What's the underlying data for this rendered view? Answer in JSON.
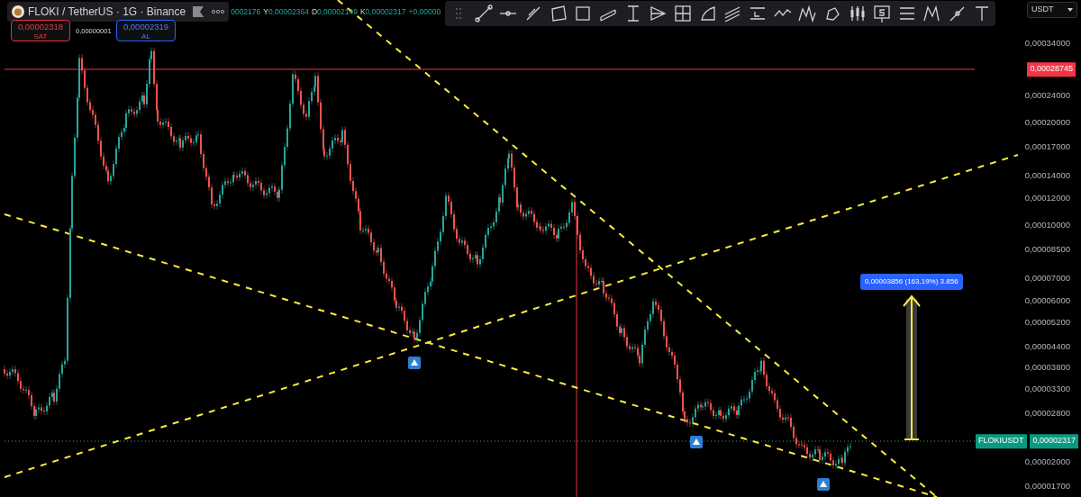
{
  "header": {
    "pair": "FLOKI / TetherUS · 1G · Binance",
    "ohlc": [
      {
        "value": "0002176"
      },
      {
        "label": "Y",
        "value": "0,00002364"
      },
      {
        "label": "D",
        "value": "0,00002149"
      },
      {
        "label": "K",
        "value": "0,00002317"
      },
      {
        "value": "+0,00000"
      }
    ]
  },
  "order": {
    "sell": {
      "price": "0,00002318",
      "label": "SAT"
    },
    "spread": "0,00000001",
    "buy": {
      "price": "0,00002319",
      "label": "AL"
    }
  },
  "currency": "USDT",
  "price_axis": [
    "0,00034000",
    "0,00024000",
    "0,00020000",
    "0,00017000",
    "0,00014000",
    "0,00012000",
    "0,00010000",
    "0,00008500",
    "0,00007000",
    "0,00006000",
    "0,00005200",
    "0,00004400",
    "0,00003800",
    "0,00003300",
    "0,00002800",
    "0,00002000",
    "0,00001700"
  ],
  "alert_price": "0,00028745",
  "current": {
    "symbol": "FLOKIUSDT",
    "price": "0,00002317"
  },
  "measure_label": "0,00003856 (163,19%) 3.856"
}
